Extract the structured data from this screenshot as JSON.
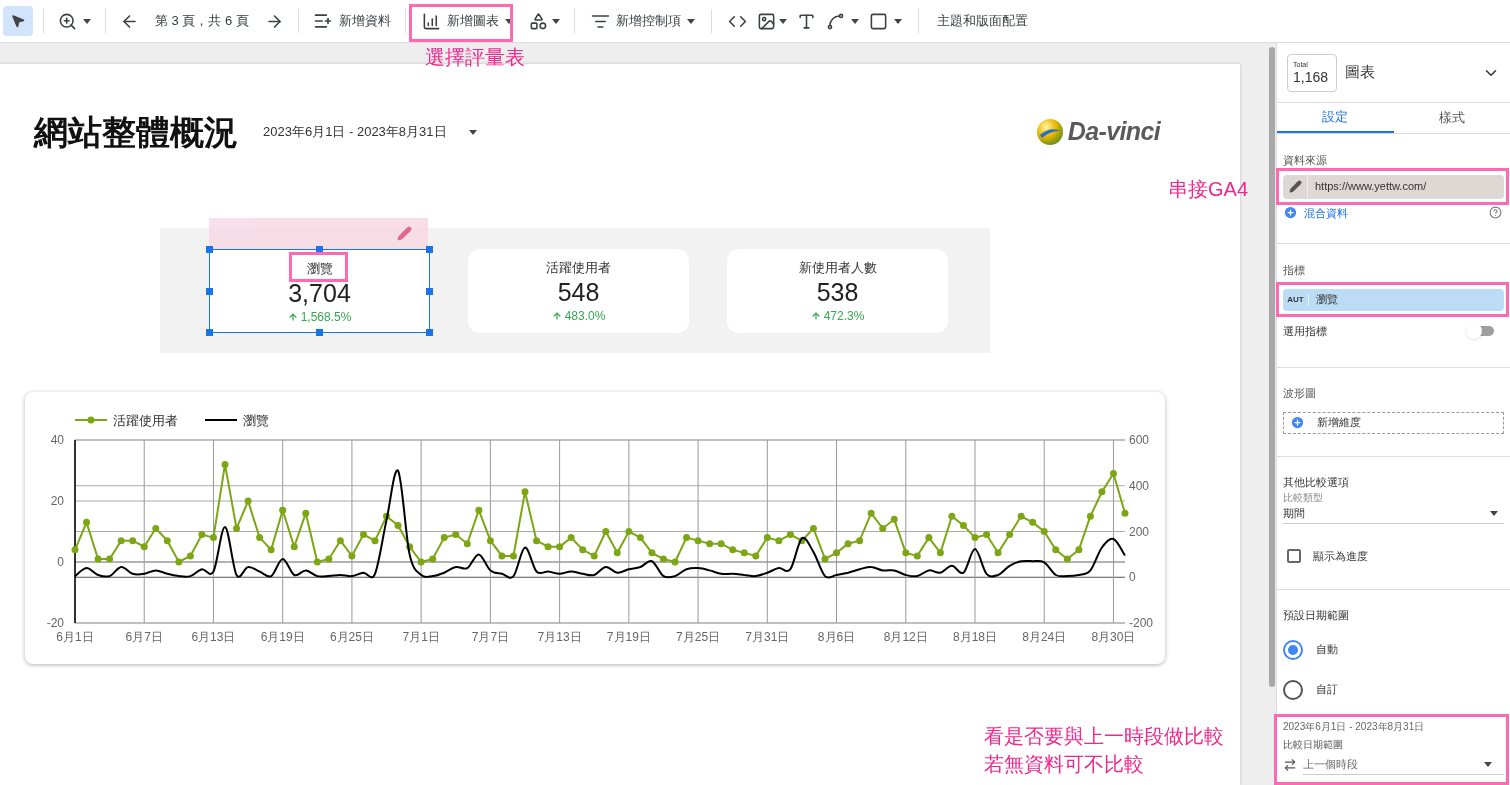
{
  "toolbar": {
    "pointer_selected": true,
    "page_indicator": "第 3 頁，共 6 頁",
    "add_data": "新增資料",
    "add_chart": "新增圖表",
    "add_control": "新增控制項",
    "theme": "主題和版面配置"
  },
  "report": {
    "title": "網站整體概況",
    "date_range": "2023年6月1日 - 2023年8月31日",
    "logo": "Da-vinci",
    "scorecards": [
      {
        "label": "瀏覽",
        "value": "3,704",
        "delta": "1,568.5%",
        "selected": true
      },
      {
        "label": "活躍使用者",
        "value": "548",
        "delta": "483.0%",
        "selected": false
      },
      {
        "label": "新使用者人數",
        "value": "538",
        "delta": "472.3%",
        "selected": false
      }
    ],
    "chart_data": {
      "type": "line",
      "grid": true,
      "legend": true,
      "categories": [
        "6月1日",
        null,
        null,
        null,
        null,
        null,
        "6月7日",
        null,
        null,
        null,
        null,
        null,
        "6月13日",
        null,
        null,
        null,
        null,
        null,
        "6月19日",
        null,
        null,
        null,
        null,
        null,
        "6月25日",
        null,
        null,
        null,
        null,
        null,
        "7月1日",
        null,
        null,
        null,
        null,
        null,
        "7月7日",
        null,
        null,
        null,
        null,
        null,
        "7月13日",
        null,
        null,
        null,
        null,
        null,
        "7月19日",
        null,
        null,
        null,
        null,
        null,
        "7月25日",
        null,
        null,
        null,
        null,
        null,
        "7月31日",
        null,
        null,
        null,
        null,
        null,
        "8月6日",
        null,
        null,
        null,
        null,
        null,
        "8月12日",
        null,
        null,
        null,
        null,
        null,
        "8月18日",
        null,
        null,
        null,
        null,
        null,
        "8月24日",
        null,
        null,
        null,
        null,
        null,
        "8月30日",
        null
      ],
      "ylim": [
        -20,
        40
      ],
      "yticks": [
        -20,
        0,
        20,
        40
      ],
      "y2lim": [
        -200,
        600
      ],
      "y2ticks": [
        -200,
        0,
        200,
        400,
        600
      ],
      "series": [
        {
          "name": "活躍使用者",
          "color": "#7da614",
          "marker": "circle",
          "values": [
            4,
            13,
            1,
            1,
            7,
            7,
            5,
            11,
            7,
            0,
            2,
            9,
            8,
            32,
            11,
            20,
            8,
            4,
            17,
            5,
            16,
            0,
            1,
            7,
            2,
            9,
            7,
            15,
            12,
            5,
            0,
            1,
            8,
            9,
            6,
            17,
            7,
            2,
            2,
            23,
            7,
            5,
            5,
            8,
            4,
            2,
            10,
            3,
            10,
            8,
            3,
            1,
            0,
            8,
            7,
            6,
            6,
            4,
            3,
            2,
            8,
            7,
            9,
            7,
            11,
            1,
            3,
            6,
            7,
            16,
            11,
            14,
            3,
            2,
            8,
            3,
            15,
            12,
            8,
            9,
            3,
            9,
            15,
            13,
            10,
            4,
            1,
            4,
            15,
            23,
            29,
            16
          ]
        },
        {
          "name": "瀏覽",
          "color": "#000000",
          "axis": "y2",
          "values": [
            5,
            40,
            10,
            5,
            45,
            15,
            15,
            30,
            15,
            5,
            5,
            35,
            25,
            220,
            10,
            45,
            25,
            5,
            80,
            10,
            30,
            5,
            5,
            10,
            5,
            20,
            15,
            250,
            465,
            100,
            10,
            5,
            20,
            45,
            40,
            100,
            30,
            15,
            5,
            130,
            25,
            25,
            15,
            25,
            15,
            10,
            45,
            20,
            35,
            45,
            70,
            5,
            5,
            35,
            40,
            30,
            15,
            15,
            10,
            5,
            20,
            40,
            35,
            170,
            110,
            5,
            10,
            20,
            35,
            45,
            30,
            30,
            10,
            5,
            30,
            20,
            50,
            20,
            123,
            15,
            10,
            50,
            70,
            70,
            65,
            10,
            5,
            10,
            30,
            130,
            167,
            95
          ]
        }
      ]
    }
  },
  "panel": {
    "thumbnail_label": "Total",
    "thumbnail_value": "1,168",
    "chart_type": "圖表",
    "tabs": [
      {
        "label": "設定",
        "selected": true
      },
      {
        "label": "樣式",
        "selected": false
      }
    ],
    "data_source_label": "資料來源",
    "data_source": "https://www.yettw.com/",
    "blend_link": "混合資料",
    "metric_label": "指標",
    "metric_tag": "AUT",
    "metric": "瀏覽",
    "optional_metric": {
      "label": "選用指標",
      "on": false
    },
    "sparkline_label": "波形圖",
    "add_dimension": "新增維度",
    "comparison_label": "其他比較選項",
    "comparison_type_label": "比較類型",
    "comparison_type": "期間",
    "progress": {
      "label": "顯示為進度",
      "checked": false
    },
    "date_range_label": "預設日期範圍",
    "date_options": [
      {
        "label": "自動",
        "selected": true
      },
      {
        "label": "自訂",
        "selected": false
      }
    ],
    "current_range": "2023年6月1日 - 2023年8月31日",
    "compare_range_label": "比較日期範圍",
    "compare_range": "上一個時段"
  },
  "annotations": {
    "chart_picker": "選擇評量表",
    "data_source": "串接GA4",
    "comparison": [
      "看是否要與上一時段做比較",
      "若無資料可不比較"
    ]
  }
}
